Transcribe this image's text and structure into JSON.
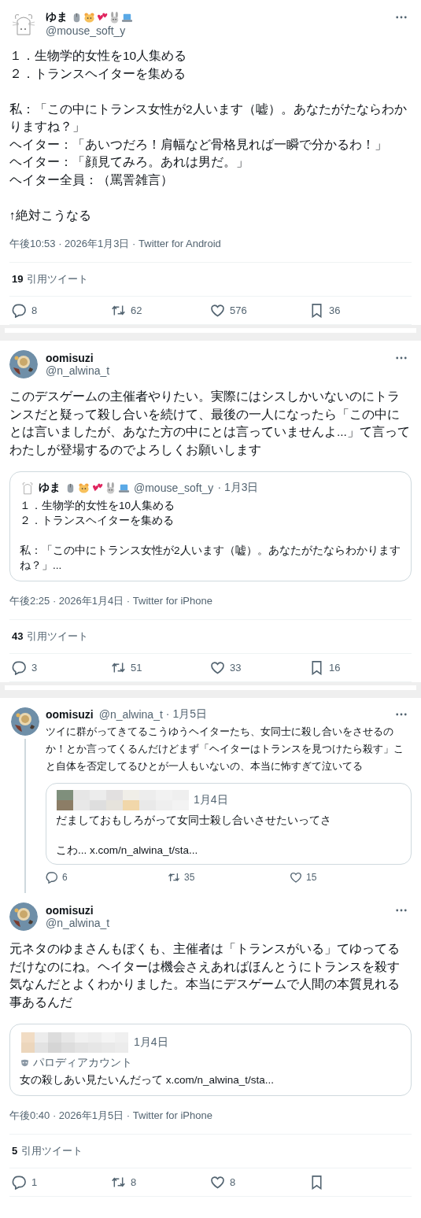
{
  "tweets": [
    {
      "kind": "main",
      "author": {
        "name": "ゆま",
        "handle": "@mouse_soft_y",
        "kind": "mouse"
      },
      "text": [
        [
          "１．生物学的女性を10人集める",
          "２．トランスヘイターを集める"
        ],
        [
          "私：「この中にトランス女性が2人います（嘘）。あなたがたならわかりますね？」",
          "ヘイター：「あいつだろ！肩幅など骨格見れば一瞬で分かるわ！」",
          "ヘイター：「顔見てみろ。あれは男だ。」",
          "ヘイター全員：（罵詈雑言）"
        ],
        [
          "↑絶対こうなる"
        ]
      ],
      "meta": "午後10:53 · 2026年1月3日 · Twitter for Android",
      "quote_count": "19",
      "quote_label": "引用ツイート",
      "actions": [
        {
          "kind": "reply",
          "count": "8"
        },
        {
          "kind": "retweet",
          "count": "62"
        },
        {
          "kind": "like",
          "count": "576"
        },
        {
          "kind": "bookmark",
          "count": "36"
        }
      ],
      "separator_after": true
    },
    {
      "kind": "main",
      "author": {
        "name": "oomisuzi",
        "handle": "@n_alwina_t",
        "kind": "food"
      },
      "text": [
        [
          "このデスゲームの主催者やりたい。実際にはシスしかいないのにトランスだと疑って殺し合いを続けて、最後の一人になったら「この中にとは言いましたが、あなた方の中にとは言っていませんよ...」て言ってわたしが登場するのでよろしくお願いします"
        ]
      ],
      "quote": {
        "blurred": false,
        "author": {
          "name": "ゆま",
          "handle": "@mouse_soft_y",
          "kind": "mouse"
        },
        "date": "· 1月3日",
        "text": [
          [
            "１．生物学的女性を10人集める",
            "２．トランスヘイターを集める"
          ],
          [
            "私：「この中にトランス女性が2人います（嘘）。あなたがたならわかりますね？」..."
          ]
        ]
      },
      "meta": "午後2:25 · 2026年1月4日 · Twitter for iPhone",
      "quote_count": "43",
      "quote_label": "引用ツイート",
      "actions": [
        {
          "kind": "reply",
          "count": "3"
        },
        {
          "kind": "retweet",
          "count": "51"
        },
        {
          "kind": "like",
          "count": "33"
        },
        {
          "kind": "bookmark",
          "count": "16"
        }
      ],
      "separator_after": true
    },
    {
      "kind": "reply",
      "author": {
        "name": "oomisuzi",
        "handle": "@n_alwina_t",
        "kind": "food"
      },
      "date": "· 1月5日",
      "text": [
        [
          "ツイに群がってきてるこうゆうヘイターたち、女同士に殺し合いをさせるのか！とか言ってくるんだけどまず「ヘイターはトランスを見つけたら殺す」こと自体を否定してるひとが一人もいないの、本当に怖すぎて泣いてる"
        ]
      ],
      "quote": {
        "blurred": true,
        "date": "1月4日",
        "text": [
          [
            "だましておもしろがって女同士殺し合いさせたいってさ"
          ],
          [
            "こわ... x.com/n_alwina_t/sta..."
          ]
        ]
      },
      "actions": [
        {
          "kind": "reply",
          "count": "6"
        },
        {
          "kind": "retweet",
          "count": "35"
        },
        {
          "kind": "like",
          "count": "15"
        }
      ],
      "separator_after": false
    },
    {
      "kind": "main",
      "author": {
        "name": "oomisuzi",
        "handle": "@n_alwina_t",
        "kind": "food"
      },
      "text": [
        [
          "元ネタのゆまさんもぼくも、主催者は「トランスがいる」てゆってるだけなのにね。ヘイターは機会さえあればほんとうにトランスを殺す気なんだとよくわかりました。本当にデスゲームで人間の本質見れる事あるんだ"
        ]
      ],
      "quote": {
        "blurred": true,
        "date": "1月4日",
        "label": "パロディアカウント",
        "text": [
          [
            "女の殺しあい見たいんだって x.com/n_alwina_t/sta..."
          ]
        ]
      },
      "meta": "午後0:40 · 2026年1月5日 · Twitter for iPhone",
      "quote_count": "5",
      "quote_label": "引用ツイート",
      "actions": [
        {
          "kind": "reply",
          "count": "1"
        },
        {
          "kind": "retweet",
          "count": "8"
        },
        {
          "kind": "like",
          "count": "8"
        },
        {
          "kind": "bookmark"
        }
      ],
      "separator_after": false
    }
  ]
}
